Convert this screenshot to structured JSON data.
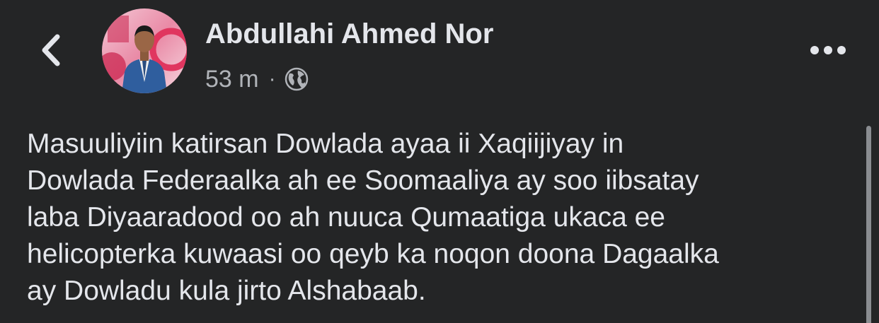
{
  "header": {
    "back_icon": "chevron-left-icon",
    "author_name": "Abdullahi Ahmed Nor",
    "time": "53 m",
    "separator": "·",
    "privacy_icon": "globe-icon",
    "more_icon": "more-horizontal-icon"
  },
  "post": {
    "lines": [
      "Masuuliyiin katirsan Dowlada ayaa ii Xaqiijiyay in",
      "Dowlada Federaalka ah ee Soomaaliya ay soo iibsatay",
      "laba Diyaaradood oo ah nuuca Qumaatiga ukaca ee",
      "helicopterka kuwaasi oo qeyb ka noqon doona Dagaalka",
      "ay Dowladu kula jirto Alshabaab."
    ]
  },
  "colors": {
    "background": "#242526",
    "primary_text": "#e4e6eb",
    "secondary_text": "#b0b3b8"
  }
}
